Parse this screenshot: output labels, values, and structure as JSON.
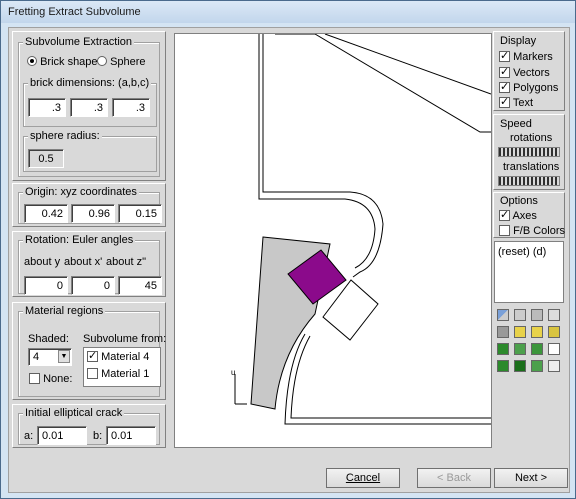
{
  "window": {
    "title": "Fretting Extract Subvolume"
  },
  "subvolume": {
    "legend": "Subvolume Extraction",
    "brick_label": "Brick shape",
    "sphere_label": "Sphere",
    "selected": "brick",
    "brick_dims_legend": "brick dimensions: (a,b,c)",
    "a": ".3",
    "b": ".3",
    "c": ".3",
    "sphere_radius_legend": "sphere radius:",
    "sphere_radius": "0.5"
  },
  "origin": {
    "legend": "Origin: xyz coordinates",
    "x": "0.42",
    "y": "0.96",
    "z": "0.15"
  },
  "rotation": {
    "legend": "Rotation: Euler angles",
    "about_y_label": "about y",
    "about_x_label": "about x'",
    "about_z_label": "about z\"",
    "about_y": "0",
    "about_x": "0",
    "about_z": "45"
  },
  "material": {
    "legend": "Material regions",
    "shaded_label": "Shaded:",
    "shaded_value": "4",
    "none_label": "None:",
    "subvolume_from_label": "Subvolume from:",
    "items": [
      {
        "label": "Material 4",
        "checked": true
      },
      {
        "label": "Material 1",
        "checked": false
      }
    ]
  },
  "crack": {
    "legend": "Initial elliptical crack",
    "a_label": "a:",
    "a": "0.01",
    "b_label": "b:",
    "b": "0.01"
  },
  "display": {
    "legend": "Display",
    "items": [
      {
        "label": "Markers",
        "checked": true
      },
      {
        "label": "Vectors",
        "checked": true
      },
      {
        "label": "Polygons",
        "checked": true
      },
      {
        "label": "Text",
        "checked": true
      }
    ]
  },
  "speed": {
    "legend": "Speed",
    "rotations_label": "rotations",
    "translations_label": "translations"
  },
  "options": {
    "legend": "Options",
    "axes_label": "Axes",
    "axes_checked": true,
    "fb_label": "F/B Colors",
    "fb_checked": false
  },
  "log": {
    "text": "(reset) (d)"
  },
  "buttons": {
    "cancel": "Cancel",
    "back": "< Back",
    "next": "Next >"
  },
  "viewport": {
    "axis_label": "u"
  },
  "colors": {
    "cube": "#8b0a8b",
    "shaded_region": "#c8c8c8"
  },
  "toolbar_icons": [
    "view-front-icon",
    "view-back-icon",
    "view-side-icon",
    "view-other-icon",
    "view-top-icon",
    "view-iso-icon",
    "view-yellow-icon",
    "view-yellow2-icon",
    "cube-green1-icon",
    "cube-green2-icon",
    "cube-green3-icon",
    "cube-wire-icon",
    "cube-green4-icon",
    "cube-green5-icon",
    "cube-green6-icon",
    "cube-outline-icon"
  ]
}
